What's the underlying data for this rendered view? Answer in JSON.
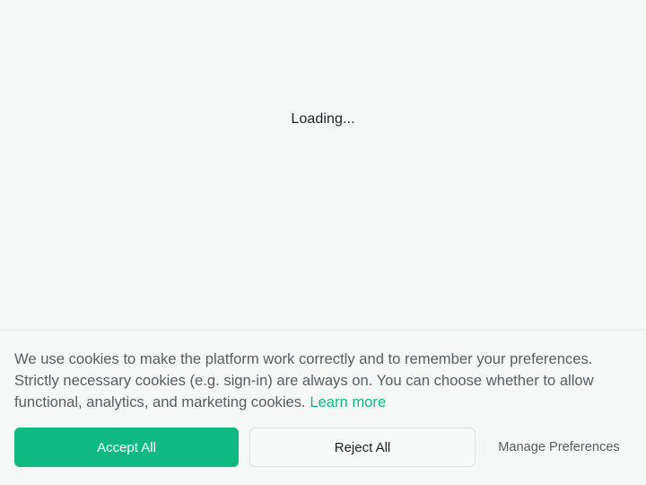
{
  "loading": {
    "text": "Loading..."
  },
  "cookie_banner": {
    "message": "We use cookies to make the platform work correctly and to remember your preferences. Strictly necessary cookies (e.g. sign-in) are always on. You can choose whether to allow functional, analytics, and marketing cookies.",
    "learn_more_label": "Learn more",
    "accept_label": "Accept All",
    "reject_label": "Reject All",
    "manage_label": "Manage Preferences"
  },
  "colors": {
    "accent": "#10b981",
    "background": "#f6f8f8",
    "text_muted": "#555d63",
    "text_dark": "#1c2024"
  }
}
